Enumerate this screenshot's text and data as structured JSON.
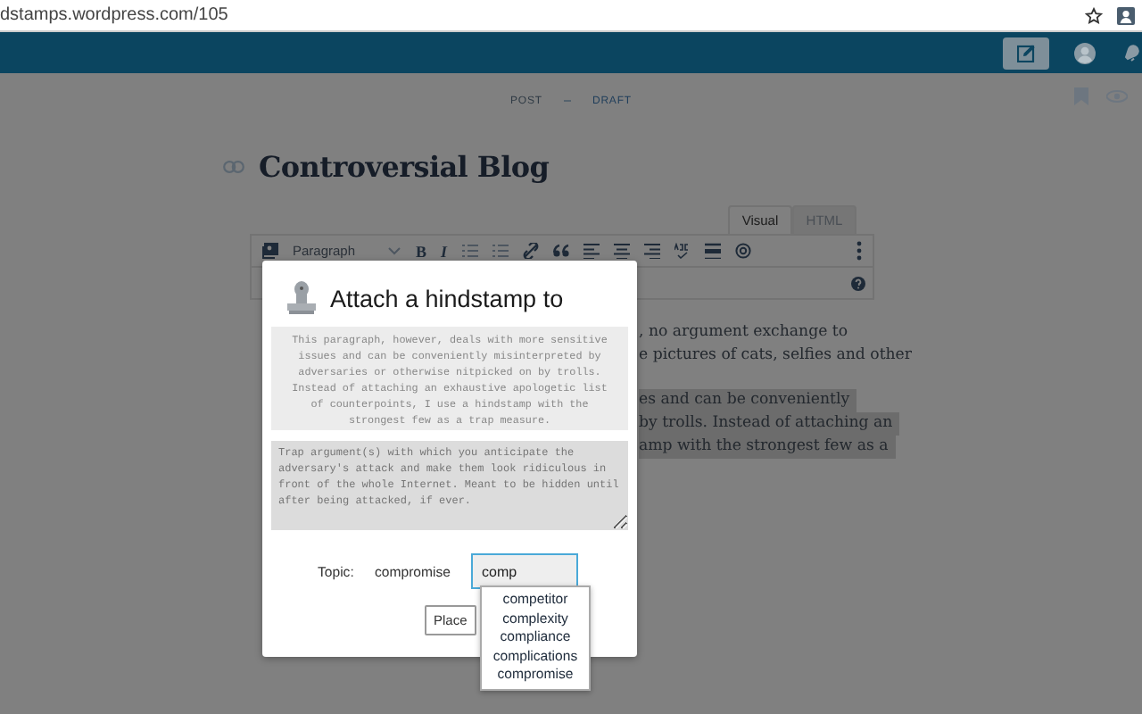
{
  "browser": {
    "url": "dstamps.wordpress.com/105"
  },
  "post_status": {
    "type": "POST",
    "state": "DRAFT"
  },
  "editor": {
    "title": "Controversial Blog",
    "tabs": [
      {
        "label": "Visual",
        "selected": true
      },
      {
        "label": "HTML",
        "selected": false
      }
    ],
    "format": "Paragraph",
    "bold": "B",
    "italic": "I",
    "paragraphs": [
      {
        "highlighted": false,
        "lines": [
          ", no argument exchange to",
          "e pictures of cats, selfies and other"
        ]
      },
      {
        "highlighted": true,
        "lines": [
          "es and can be conveniently",
          "by trolls. Instead of attaching an",
          "amp with the strongest few as a"
        ]
      }
    ]
  },
  "dialog": {
    "title": "Attach a hindstamp to",
    "quote": "This paragraph, however, deals with more sensitive issues and can be conveniently misinterpreted by adversaries or otherwise nitpicked on by trolls. Instead of attaching an exhaustive apologetic list of counterpoints, I use a hindstamp with the strongest few as a trap measure.",
    "argument": {
      "placeholder": "Trap argument(s) with which you anticipate the adversary's attack and make them look ridiculous in front of the whole Internet. Meant to be hidden until after being attacked, if ever."
    },
    "topic_label": "Topic:",
    "topic": "compromise",
    "topic_input": "comp",
    "place_button": "Place",
    "suggestions": [
      "competitor",
      "complexity",
      "compliance",
      "complications",
      "compromise"
    ]
  }
}
